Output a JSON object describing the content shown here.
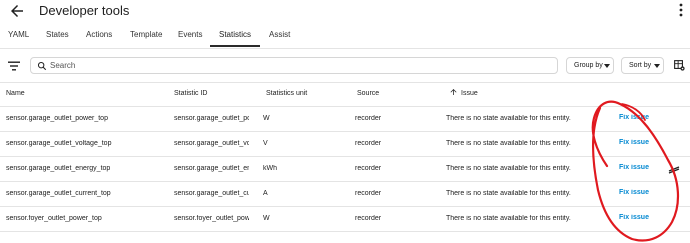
{
  "header": {
    "title": "Developer tools"
  },
  "tabs": [
    {
      "label": "YAML"
    },
    {
      "label": "States"
    },
    {
      "label": "Actions"
    },
    {
      "label": "Template"
    },
    {
      "label": "Events"
    },
    {
      "label": "Statistics"
    },
    {
      "label": "Assist"
    }
  ],
  "active_tab": "Statistics",
  "search": {
    "placeholder": "Search",
    "value": ""
  },
  "group_by": {
    "label": "Group by"
  },
  "sort_by": {
    "label": "Sort by"
  },
  "columns": {
    "name": "Name",
    "statistic_id": "Statistic ID",
    "unit": "Statistics unit",
    "source": "Source",
    "issue": "Issue"
  },
  "rows": [
    {
      "name": "sensor.garage_outlet_power_top",
      "statistic_id": "sensor.garage_outlet_pow...",
      "unit": "W",
      "source": "recorder",
      "issue": "There is no state available for this entity.",
      "action": "Fix issue"
    },
    {
      "name": "sensor.garage_outlet_voltage_top",
      "statistic_id": "sensor.garage_outlet_volt...",
      "unit": "V",
      "source": "recorder",
      "issue": "There is no state available for this entity.",
      "action": "Fix issue"
    },
    {
      "name": "sensor.garage_outlet_energy_top",
      "statistic_id": "sensor.garage_outlet_ene...",
      "unit": "kWh",
      "source": "recorder",
      "issue": "There is no state available for this entity.",
      "action": "Fix issue"
    },
    {
      "name": "sensor.garage_outlet_current_top",
      "statistic_id": "sensor.garage_outlet_curr...",
      "unit": "A",
      "source": "recorder",
      "issue": "There is no state available for this entity.",
      "action": "Fix issue"
    },
    {
      "name": "sensor.foyer_outlet_power_top",
      "statistic_id": "sensor.foyer_outlet_pow...",
      "unit": "W",
      "source": "recorder",
      "issue": "There is no state available for this entity.",
      "action": "Fix issue"
    }
  ],
  "colors": {
    "link": "#0288d1",
    "annotation": "#e0191f",
    "divider": "#e4e4e4"
  },
  "icons": {
    "back": "arrow-left-icon",
    "menu": "dots-vertical-icon",
    "filter": "filter-variant-icon",
    "search": "magnify-icon",
    "sort": "arrow-up-icon",
    "settings": "table-cog-icon",
    "ignore": "slash-icon"
  }
}
